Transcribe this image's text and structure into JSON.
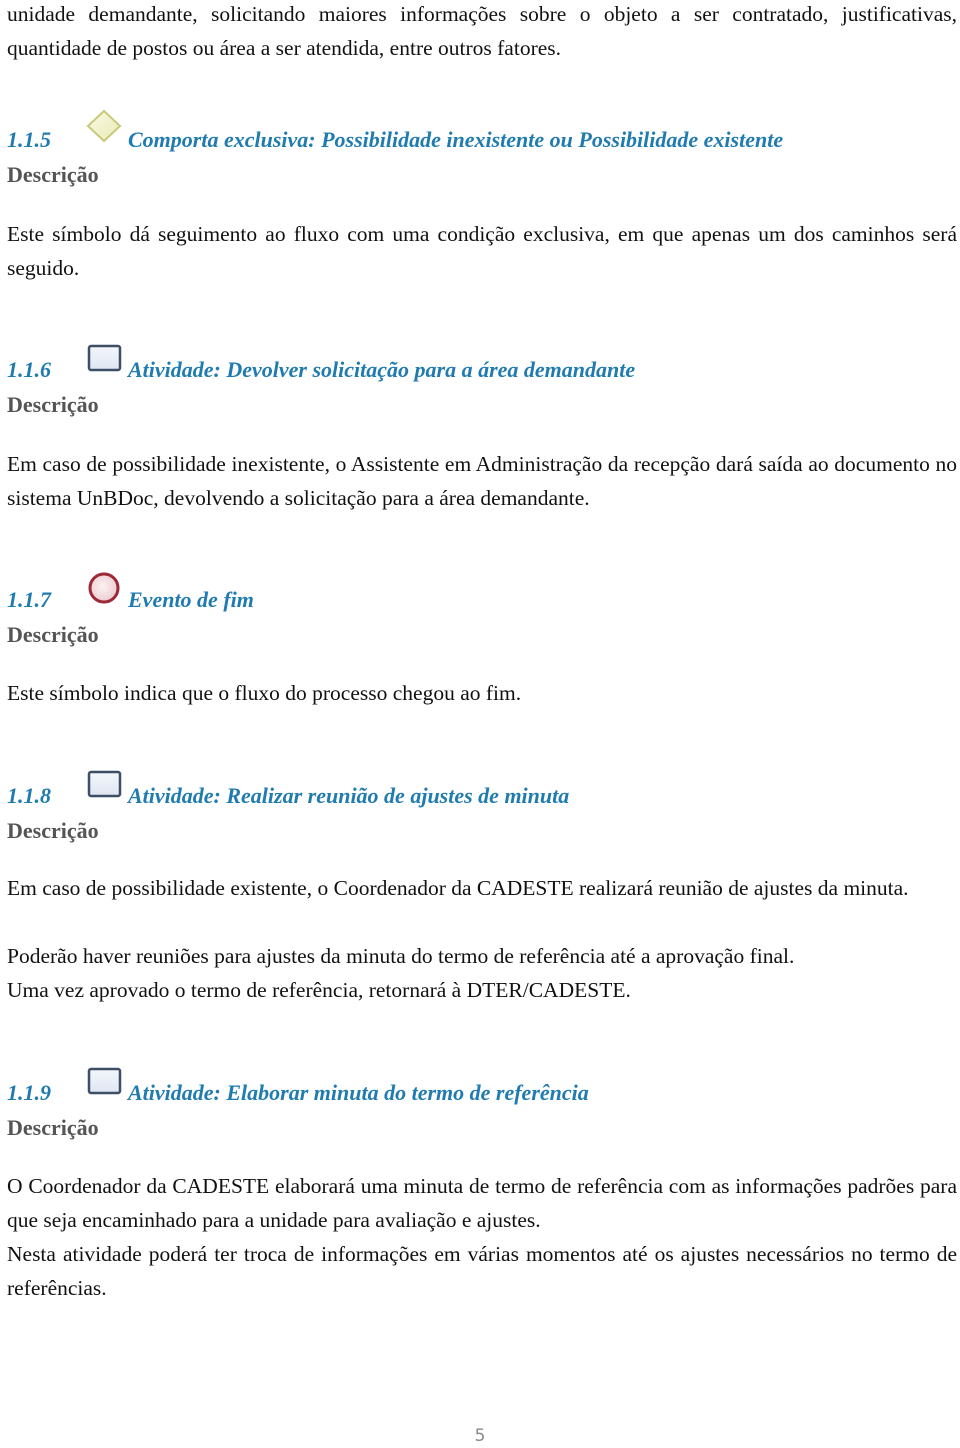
{
  "intro": {
    "lines": [
      "unidade demandante, solicitando maiores informações sobre o objeto a ser contratado,",
      "justificativas, quantidade de postos ou área a ser atendida, entre outros fatores."
    ]
  },
  "sections": [
    {
      "number": "1.1.5",
      "icon": "gateway-diamond-icon",
      "title": "Comporta exclusiva: Possibilidade inexistente ou Possibilidade existente",
      "desc_label": "Descrição",
      "paragraphs": [
        "Este símbolo dá seguimento ao fluxo com uma condição exclusiva, em que apenas um dos caminhos será seguido."
      ]
    },
    {
      "number": "1.1.6",
      "icon": "activity-task-icon",
      "title": "Atividade: Devolver solicitação para a área demandante",
      "desc_label": "Descrição",
      "paragraphs": [
        "Em caso de possibilidade inexistente, o Assistente em Administração da recepção dará saída ao documento no sistema UnBDoc, devolvendo a solicitação para a área demandante."
      ]
    },
    {
      "number": "1.1.7",
      "icon": "end-event-circle-icon",
      "title": "Evento de fim",
      "desc_label": "Descrição",
      "paragraphs": [
        "Este símbolo indica que o fluxo do processo chegou ao fim."
      ]
    },
    {
      "number": "1.1.8",
      "icon": "activity-task-icon",
      "title": "Atividade: Realizar reunião de ajustes de minuta",
      "desc_label": "Descrição",
      "paragraphs": [
        "Em caso de possibilidade existente, o Coordenador da CADESTE realizará reunião de ajustes da minuta.",
        "Poderão haver reuniões para ajustes da minuta do termo de referência até a aprovação final.",
        "Uma vez aprovado o termo de referência, retornará à DTER/CADESTE."
      ]
    },
    {
      "number": "1.1.9",
      "icon": "activity-task-icon",
      "title": "Atividade: Elaborar minuta do termo de referência",
      "desc_label": "Descrição",
      "paragraphs": [
        "O Coordenador da CADESTE elaborará uma minuta de termo de referência com as informações padrões para que seja encaminhado para a unidade para avaliação e ajustes.",
        "Nesta atividade poderá ter troca de informações em várias  momentos até os ajustes necessários no termo de referências."
      ]
    }
  ],
  "page_number": "5",
  "colors": {
    "heading": "#1f7bb0",
    "desc_label": "#555555",
    "body_text": "#111111"
  }
}
